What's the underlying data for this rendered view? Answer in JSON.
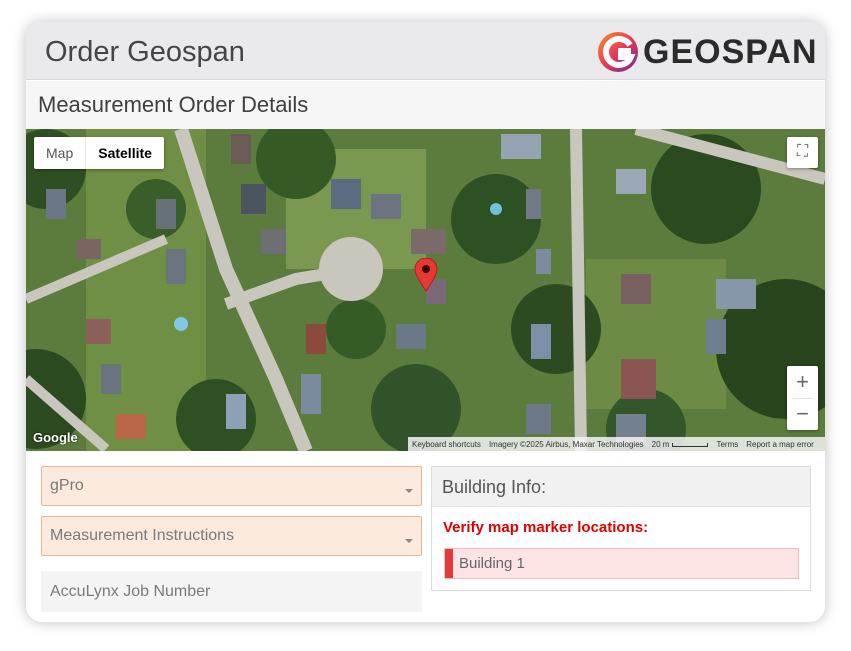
{
  "header": {
    "title": "Order Geospan",
    "logo_text": "GEOSPAN"
  },
  "section": {
    "title": "Measurement Order Details"
  },
  "map": {
    "type_map_label": "Map",
    "type_satellite_label": "Satellite",
    "active_type": "Satellite",
    "zoom_in_label": "+",
    "zoom_out_label": "−",
    "fullscreen_icon": "fullscreen-icon",
    "google_label": "Google",
    "attribution": {
      "keyboard": "Keyboard shortcuts",
      "imagery": "Imagery ©2025 Airbus, Maxar Technologies",
      "scale": "20 m",
      "terms": "Terms",
      "report": "Report a map error"
    },
    "marker_icon": "map-pin-icon"
  },
  "form": {
    "product_value": "gPro",
    "instructions_placeholder": "Measurement Instructions",
    "job_number_placeholder": "AccuLynx Job Number"
  },
  "building_info": {
    "title": "Building Info:",
    "warning": "Verify map marker locations:",
    "buildings": [
      "Building 1"
    ]
  },
  "colors": {
    "warning": "#e00000",
    "field_bg": "#fdeade",
    "field_border": "#f2b48c",
    "building_marker": "#e23b3b"
  }
}
